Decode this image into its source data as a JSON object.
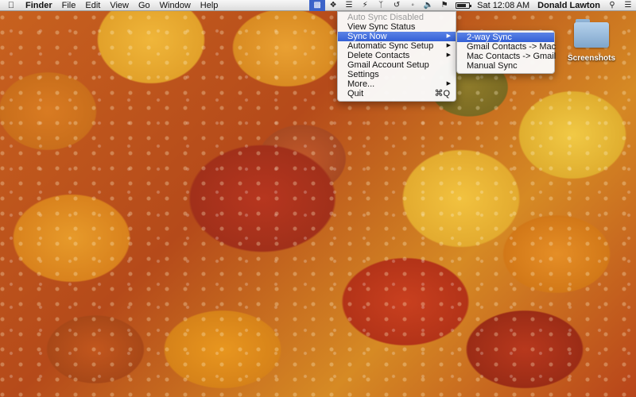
{
  "menubar": {
    "apple_icon": "apple-icon",
    "app_name": "Finder",
    "menus": [
      "File",
      "Edit",
      "View",
      "Go",
      "Window",
      "Help"
    ],
    "status_icons": [
      "sync-app-icon",
      "dropbox-icon",
      "stack-icon",
      "bolt-icon",
      "bluetooth-icon",
      "time-machine-icon",
      "wifi-icon",
      "volume-icon",
      "flag-icon",
      "battery-icon"
    ],
    "clock": "Sat 12:08 AM",
    "user": "Donald Lawton",
    "battery_level": 0.75
  },
  "sync_menu": {
    "items": [
      {
        "label": "Auto Sync Disabled",
        "state": "disabled"
      },
      {
        "label": "View Sync Status"
      },
      {
        "label": "Sync Now",
        "state": "selected",
        "submenu": true
      },
      {
        "label": "Automatic Sync Setup",
        "submenu": true
      },
      {
        "label": "Delete Contacts",
        "submenu": true
      },
      {
        "label": "Gmail Account Setup"
      },
      {
        "label": "Settings"
      },
      {
        "label": "More...",
        "submenu": true
      },
      {
        "label": "Quit",
        "shortcut": "⌘Q"
      }
    ]
  },
  "sync_now_submenu": {
    "items": [
      {
        "label": "2-way Sync",
        "state": "selected"
      },
      {
        "label": "Gmail Contacts -> Mac"
      },
      {
        "label": "Mac Contacts -> Gmail"
      },
      {
        "label": "Manual Sync"
      }
    ]
  },
  "desktop": {
    "folder_label": "Screenshots"
  }
}
